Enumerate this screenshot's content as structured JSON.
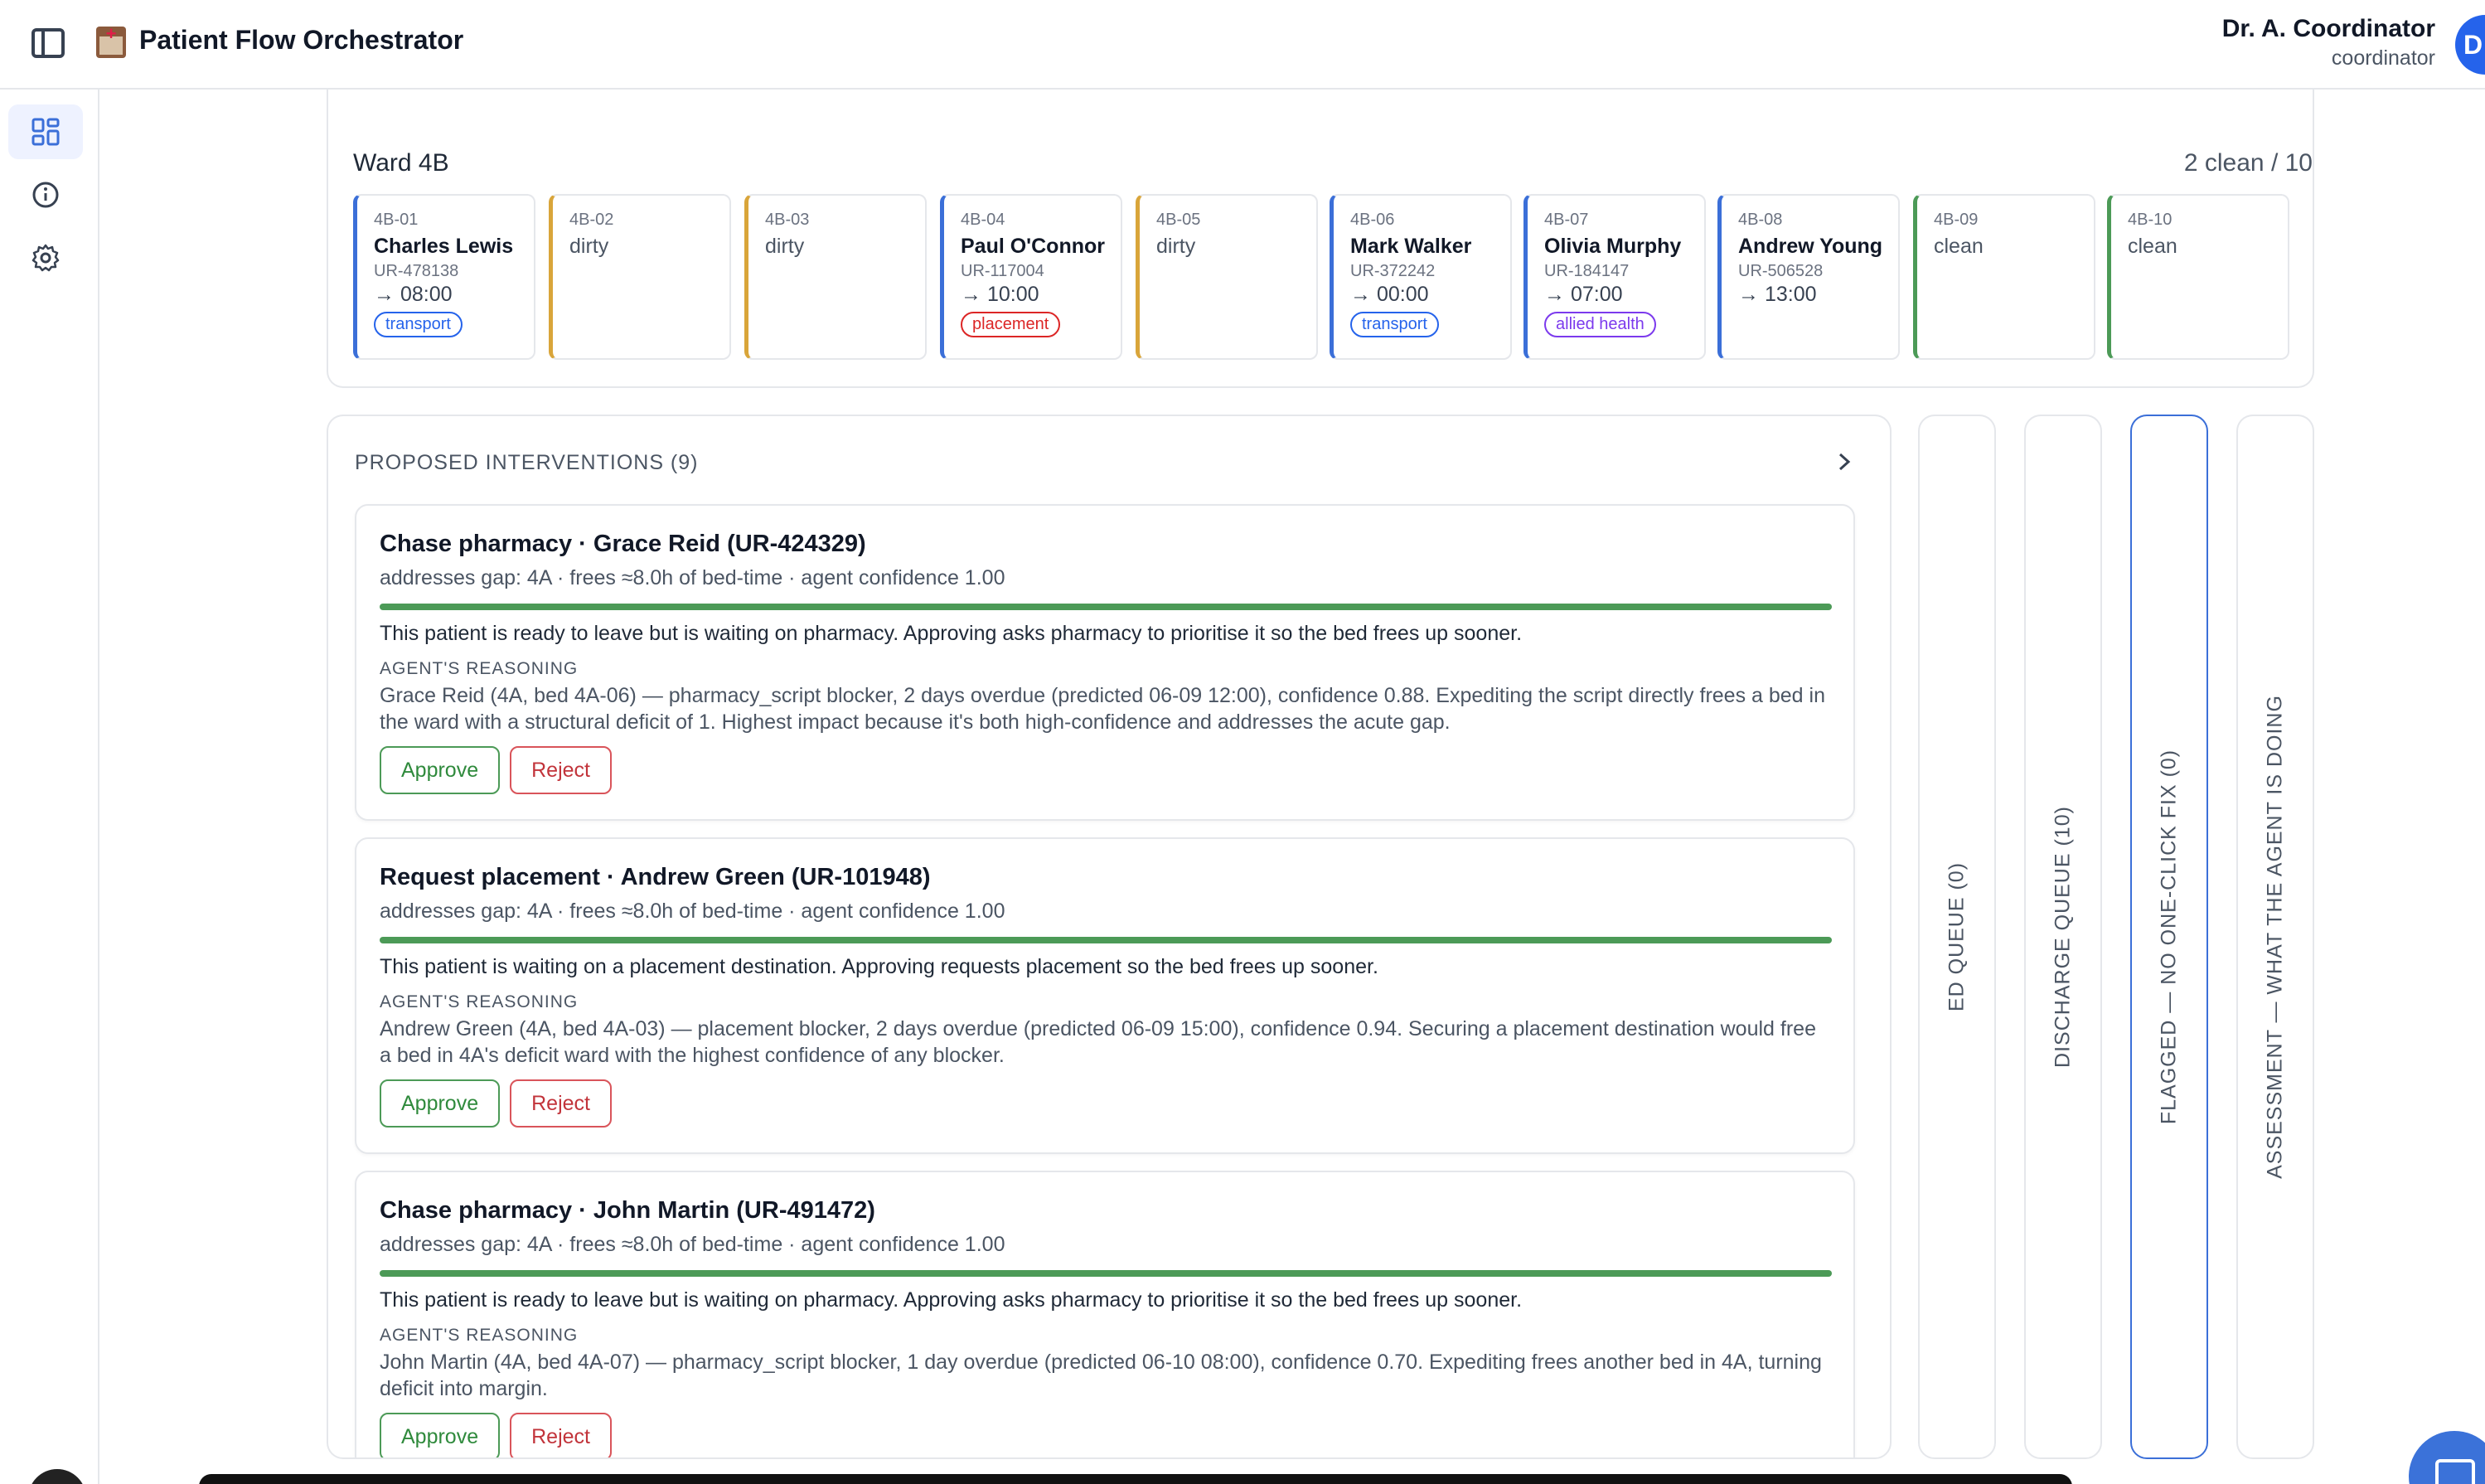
{
  "app": {
    "title": "Patient Flow Orchestrator"
  },
  "user": {
    "name": "Dr. A. Coordinator",
    "role": "coordinator",
    "avatar_initial": "D"
  },
  "ward": {
    "name": "Ward 4B",
    "summary": "2 clean / 10",
    "beds": [
      {
        "id": "4B-01",
        "patient": "Charles Lewis",
        "ur": "UR-478138",
        "time": "→ 08:00",
        "tag": "transport",
        "tag_color": "#2563eb",
        "stripe": "#3b6fd8"
      },
      {
        "id": "4B-02",
        "status": "dirty",
        "stripe": "#d9a53a"
      },
      {
        "id": "4B-03",
        "status": "dirty",
        "stripe": "#d9a53a"
      },
      {
        "id": "4B-04",
        "patient": "Paul O'Connor",
        "ur": "UR-117004",
        "time": "→ 10:00",
        "tag": "placement",
        "tag_color": "#dc2626",
        "stripe": "#3b6fd8"
      },
      {
        "id": "4B-05",
        "status": "dirty",
        "stripe": "#d9a53a"
      },
      {
        "id": "4B-06",
        "patient": "Mark Walker",
        "ur": "UR-372242",
        "time": "→ 00:00",
        "tag": "transport",
        "tag_color": "#2563eb",
        "stripe": "#3b6fd8"
      },
      {
        "id": "4B-07",
        "patient": "Olivia Murphy",
        "ur": "UR-184147",
        "time": "→ 07:00",
        "tag": "allied health",
        "tag_color": "#7c3aed",
        "stripe": "#3b6fd8"
      },
      {
        "id": "4B-08",
        "patient": "Andrew Young",
        "ur": "UR-506528",
        "time": "→ 13:00",
        "stripe": "#3b6fd8"
      },
      {
        "id": "4B-09",
        "status": "clean",
        "stripe": "#4c9a57"
      },
      {
        "id": "4B-10",
        "status": "clean",
        "stripe": "#4c9a57"
      }
    ]
  },
  "interventions": {
    "header": "PROPOSED INTERVENTIONS (9)",
    "reasoning_label": "AGENT'S REASONING",
    "approve_label": "Approve",
    "reject_label": "Reject",
    "cards": [
      {
        "title": "Chase pharmacy · Grace Reid (UR-424329)",
        "meta": "addresses gap: 4A · frees ≈8.0h of bed-time · agent confidence 1.00",
        "confidence": 1.0,
        "summary": "This patient is ready to leave but is waiting on pharmacy. Approving asks pharmacy to prioritise it so the bed frees up sooner.",
        "reasoning": "Grace Reid (4A, bed 4A-06) — pharmacy_script blocker, 2 days overdue (predicted 06-09 12:00), confidence 0.88. Expediting the script directly frees a bed in the ward with a structural deficit of 1. Highest impact because it's both high-confidence and addresses the acute gap."
      },
      {
        "title": "Request placement · Andrew Green (UR-101948)",
        "meta": "addresses gap: 4A · frees ≈8.0h of bed-time · agent confidence 1.00",
        "confidence": 1.0,
        "summary": "This patient is waiting on a placement destination. Approving requests placement so the bed frees up sooner.",
        "reasoning": "Andrew Green (4A, bed 4A-03) — placement blocker, 2 days overdue (predicted 06-09 15:00), confidence 0.94. Securing a placement destination would free a bed in 4A's deficit ward with the highest confidence of any blocker."
      },
      {
        "title": "Chase pharmacy · John Martin (UR-491472)",
        "meta": "addresses gap: 4A · frees ≈8.0h of bed-time · agent confidence 1.00",
        "confidence": 1.0,
        "summary": "This patient is ready to leave but is waiting on pharmacy. Approving asks pharmacy to prioritise it so the bed frees up sooner.",
        "reasoning": "John Martin (4A, bed 4A-07) — pharmacy_script blocker, 1 day overdue (predicted 06-10 08:00), confidence 0.70. Expediting frees another bed in 4A, turning deficit into margin."
      }
    ]
  },
  "queues": [
    {
      "label": "ED QUEUE (0)"
    },
    {
      "label": "DISCHARGE QUEUE (10)"
    },
    {
      "label": "FLAGGED — NO ONE-CLICK FIX (0)"
    },
    {
      "label": "ASSESSMENT — WHAT THE AGENT IS DOING"
    }
  ],
  "colors": {
    "accent": "#3b6fd8",
    "approve": "#2f8a3c",
    "reject": "#c2343b",
    "dirty": "#d9a53a",
    "clean": "#4c9a57"
  }
}
